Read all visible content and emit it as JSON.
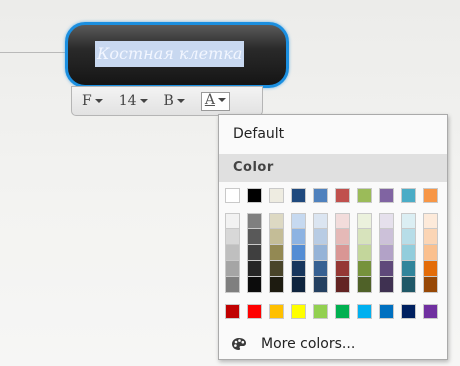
{
  "node": {
    "title": "Костная клетка"
  },
  "toolbar": {
    "font_label": "F",
    "size_label": "14",
    "bold_label": "B",
    "color_label": "A"
  },
  "color_menu": {
    "default_label": "Default",
    "section_label": "Color",
    "more_label": "More colors...",
    "palette_top": [
      "#ffffff",
      "#000000",
      "#eeece1",
      "#1f497d",
      "#4f81bd",
      "#c0504d",
      "#9bbb59",
      "#8064a2",
      "#4bacc6",
      "#f79646"
    ],
    "palette_shades": [
      [
        "#f2f2f2",
        "#d8d8d8",
        "#bfbfbf",
        "#a5a5a5",
        "#7f7f7f"
      ],
      [
        "#7f7f7f",
        "#595959",
        "#3f3f3f",
        "#262626",
        "#0c0c0c"
      ],
      [
        "#ddd9c3",
        "#c4bd97",
        "#938953",
        "#494429",
        "#1d1b10"
      ],
      [
        "#c6d9f0",
        "#8db3e2",
        "#548dd4",
        "#17365d",
        "#0f243e"
      ],
      [
        "#dbe5f1",
        "#b8cce4",
        "#95b3d7",
        "#366092",
        "#244061"
      ],
      [
        "#f2dcdb",
        "#e5b9b7",
        "#d99694",
        "#953734",
        "#632423"
      ],
      [
        "#ebf1dd",
        "#d7e3bc",
        "#c3d69b",
        "#76923c",
        "#4f6128"
      ],
      [
        "#e5e0ec",
        "#ccc1d9",
        "#b2a2c7",
        "#5f497a",
        "#3f3151"
      ],
      [
        "#dbeef3",
        "#b7dde8",
        "#92cddc",
        "#31859b",
        "#205867"
      ],
      [
        "#fdeada",
        "#fbd5b5",
        "#fac08f",
        "#e36c09",
        "#974806"
      ]
    ],
    "palette_standard": [
      "#c00000",
      "#ff0000",
      "#ffc000",
      "#ffff00",
      "#92d050",
      "#00b050",
      "#00b0f0",
      "#0070c0",
      "#002060",
      "#7030a0"
    ]
  }
}
